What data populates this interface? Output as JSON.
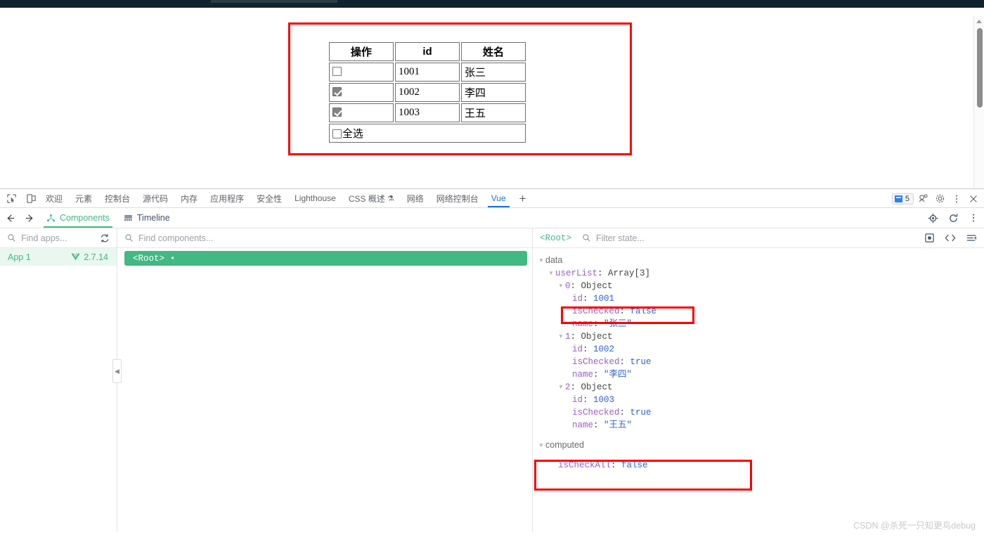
{
  "demo_page": {
    "table": {
      "headers": [
        "操作",
        "id",
        "姓名"
      ],
      "rows": [
        {
          "checked": false,
          "id": "1001",
          "name": "张三"
        },
        {
          "checked": true,
          "id": "1002",
          "name": "李四"
        },
        {
          "checked": true,
          "id": "1003",
          "name": "王五"
        }
      ],
      "select_all_label": "全选",
      "select_all_checked": false
    },
    "annotation_color": "#fe0000"
  },
  "devtools": {
    "tabs": [
      {
        "label": "欢迎",
        "active": false
      },
      {
        "label": "元素",
        "active": false
      },
      {
        "label": "控制台",
        "active": false
      },
      {
        "label": "源代码",
        "active": false
      },
      {
        "label": "内存",
        "active": false
      },
      {
        "label": "应用程序",
        "active": false
      },
      {
        "label": "安全性",
        "active": false
      },
      {
        "label": "Lighthouse",
        "active": false
      },
      {
        "label": "CSS 概述",
        "active": false,
        "flask": "⚗"
      },
      {
        "label": "网络",
        "active": false
      },
      {
        "label": "网络控制台",
        "active": false
      },
      {
        "label": "Vue",
        "active": true
      }
    ],
    "add_tab_label": "+",
    "message_count": "5",
    "active_tab_color": "#1a73e8"
  },
  "vue_devtools": {
    "accent_color": "#42b883",
    "tabs": [
      {
        "label": "Components",
        "icon": "component-tree-icon",
        "active": true
      },
      {
        "label": "Timeline",
        "icon": "timeline-icon",
        "active": false
      }
    ],
    "apps_search_placeholder": "Find apps...",
    "components_search_placeholder": "Find components...",
    "state_search_placeholder": "Filter state...",
    "app": {
      "name": "App 1",
      "version": "2.7.14"
    },
    "component_tree": [
      {
        "label": "<Root>",
        "marker": "•",
        "selected": true
      }
    ],
    "state_root_label": "<Root>"
  },
  "state_tree": {
    "groups": [
      {
        "name": "data",
        "entries": [
          {
            "key": "userList",
            "type_label": "Array[3]",
            "children": [
              {
                "index": "0",
                "type_label": "Object",
                "props": [
                  {
                    "key": "id",
                    "value": "1001",
                    "kind": "num"
                  },
                  {
                    "key": "isChecked",
                    "value": "false",
                    "kind": "bool",
                    "highlight": true
                  },
                  {
                    "key": "name",
                    "value": "\"张三\"",
                    "kind": "str"
                  }
                ]
              },
              {
                "index": "1",
                "type_label": "Object",
                "props": [
                  {
                    "key": "id",
                    "value": "1002",
                    "kind": "num"
                  },
                  {
                    "key": "isChecked",
                    "value": "true",
                    "kind": "bool"
                  },
                  {
                    "key": "name",
                    "value": "\"李四\"",
                    "kind": "str"
                  }
                ]
              },
              {
                "index": "2",
                "type_label": "Object",
                "props": [
                  {
                    "key": "id",
                    "value": "1003",
                    "kind": "num"
                  },
                  {
                    "key": "isChecked",
                    "value": "true",
                    "kind": "bool"
                  },
                  {
                    "key": "name",
                    "value": "\"王五\"",
                    "kind": "str"
                  }
                ]
              }
            ]
          }
        ]
      },
      {
        "name": "computed",
        "entries": [
          {
            "key": "isCheckAll",
            "value": "false",
            "kind": "bool",
            "highlight": true
          }
        ]
      }
    ]
  },
  "watermark": "CSDN @杀死一只知更鸟debug"
}
